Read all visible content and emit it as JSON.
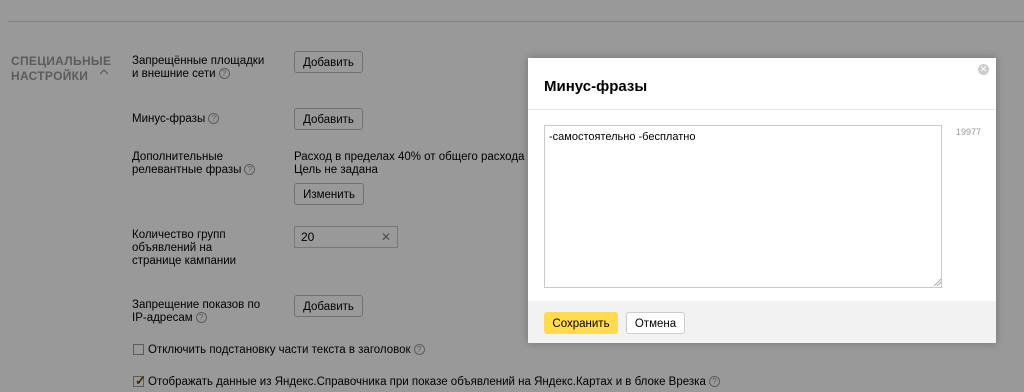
{
  "section": {
    "title": "СПЕЦИАЛЬНЫЕ НАСТРОЙКИ"
  },
  "rows": {
    "blocked_sites": {
      "label": "Запрещённые площадки и внешние сети",
      "button": "Добавить"
    },
    "minus_phrases": {
      "label": "Минус-фразы",
      "button": "Добавить"
    },
    "extra_phrases": {
      "label": "Дополнительные релевантные фразы",
      "line1": "Расход в пределах 40% от общего расхода",
      "line2": "Цель не задана",
      "button": "Изменить"
    },
    "groups_count": {
      "label": "Количество групп объявлений на странице кампании",
      "value": "20"
    },
    "ip_block": {
      "label": "Запрещение показов по IP-адресам",
      "button": "Добавить"
    },
    "checkbox1": {
      "label": "Отключить подстановку части текста в заголовок",
      "checked": false
    },
    "checkbox2": {
      "label": "Отображать данные из Яндекс.Справочника при показе объявлений на Яндекс.Картах и в блоке Врезка",
      "checked": true
    }
  },
  "modal": {
    "title": "Минус-фразы",
    "textarea_value": "-самостоятельно -бесплатно",
    "counter": "19977",
    "save": "Сохранить",
    "cancel": "Отмена"
  },
  "colors": {
    "save_button": "#ffdb4d",
    "overlay": "rgba(0,0,0,0.40)"
  }
}
